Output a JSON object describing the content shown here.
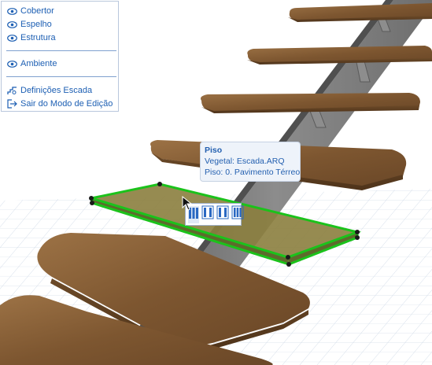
{
  "menu": {
    "items_top": [
      {
        "label": "Cobertor",
        "icon": "eye-icon"
      },
      {
        "label": "Espelho",
        "icon": "eye-icon"
      },
      {
        "label": "Estrutura",
        "icon": "eye-icon"
      }
    ],
    "item_middle": {
      "label": "Ambiente",
      "icon": "eye-icon"
    },
    "items_bottom": [
      {
        "label": "Definições Escada",
        "icon": "stair-settings-icon"
      },
      {
        "label": "Sair do Modo de Edição",
        "icon": "exit-icon"
      }
    ]
  },
  "tooltip": {
    "title": "Piso",
    "line1": "Vegetal: Escada.ARQ",
    "line2": "Piso: 0. Pavimento Térreo"
  },
  "pet_palette": {
    "buttons": [
      "tread-select-icon",
      "tread-option-1-icon",
      "tread-option-2-icon",
      "tread-option-3-icon"
    ]
  },
  "colors": {
    "menu_text": "#1d5fb3",
    "selection_outline": "#1bc21b",
    "tread_wood": "#8a6236",
    "stringer": "#7a7a7a",
    "grid": "#cdd8e6"
  }
}
